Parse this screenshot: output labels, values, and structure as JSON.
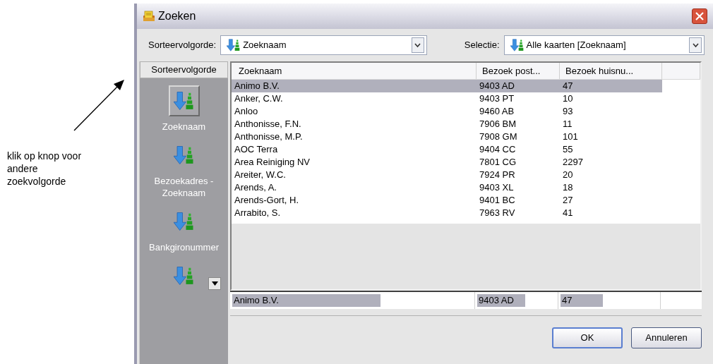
{
  "annotation": {
    "text": "klik op knop voor andere zoekvolgorde"
  },
  "window": {
    "title": "Zoeken"
  },
  "sort_combo": {
    "label": "Sorteervolgorde:",
    "value": "Zoeknaam"
  },
  "selection_combo": {
    "label": "Selectie:",
    "value": "Alle kaarten [Zoeknaam]"
  },
  "sidebar": {
    "header": "Sorteervolgorde",
    "items": [
      {
        "label": "Zoeknaam",
        "selected": true
      },
      {
        "label": "Bezoekadres - Zoeknaam",
        "selected": false
      },
      {
        "label": "Bankgironummer",
        "selected": false
      },
      {
        "selected": false
      }
    ]
  },
  "table": {
    "columns": [
      "Zoeknaam",
      "Bezoek post...",
      "Bezoek huisnu..."
    ],
    "rows": [
      {
        "cells": [
          "Animo B.V.",
          "9403 AD",
          "47"
        ],
        "selected": true
      },
      {
        "cells": [
          "Anker, C.W.",
          "9403 PT",
          "10"
        ],
        "selected": false
      },
      {
        "cells": [
          "Anloo",
          "9460 AB",
          "93"
        ],
        "selected": false
      },
      {
        "cells": [
          "Anthonisse, F.N.",
          "7906 BM",
          "11"
        ],
        "selected": false
      },
      {
        "cells": [
          "Anthonisse, M.P.",
          "7908 GM",
          "101"
        ],
        "selected": false
      },
      {
        "cells": [
          "AOC Terra",
          "9404 CC",
          "55"
        ],
        "selected": false
      },
      {
        "cells": [
          "Area Reiniging NV",
          "7801 CG",
          "2297"
        ],
        "selected": false
      },
      {
        "cells": [
          "Areiter, W.C.",
          "7924 PR",
          "20"
        ],
        "selected": false
      },
      {
        "cells": [
          "Arends, A.",
          "9403 XL",
          "18"
        ],
        "selected": false
      },
      {
        "cells": [
          "Arends-Gort, H.",
          "9401 BC",
          "27"
        ],
        "selected": false
      },
      {
        "cells": [
          "Arrabito, S.",
          "7963 RV",
          "41"
        ],
        "selected": false
      }
    ]
  },
  "search_row": [
    "Animo B.V.",
    "9403 AD",
    "47"
  ],
  "buttons": [
    "OK",
    "Annuleren"
  ]
}
